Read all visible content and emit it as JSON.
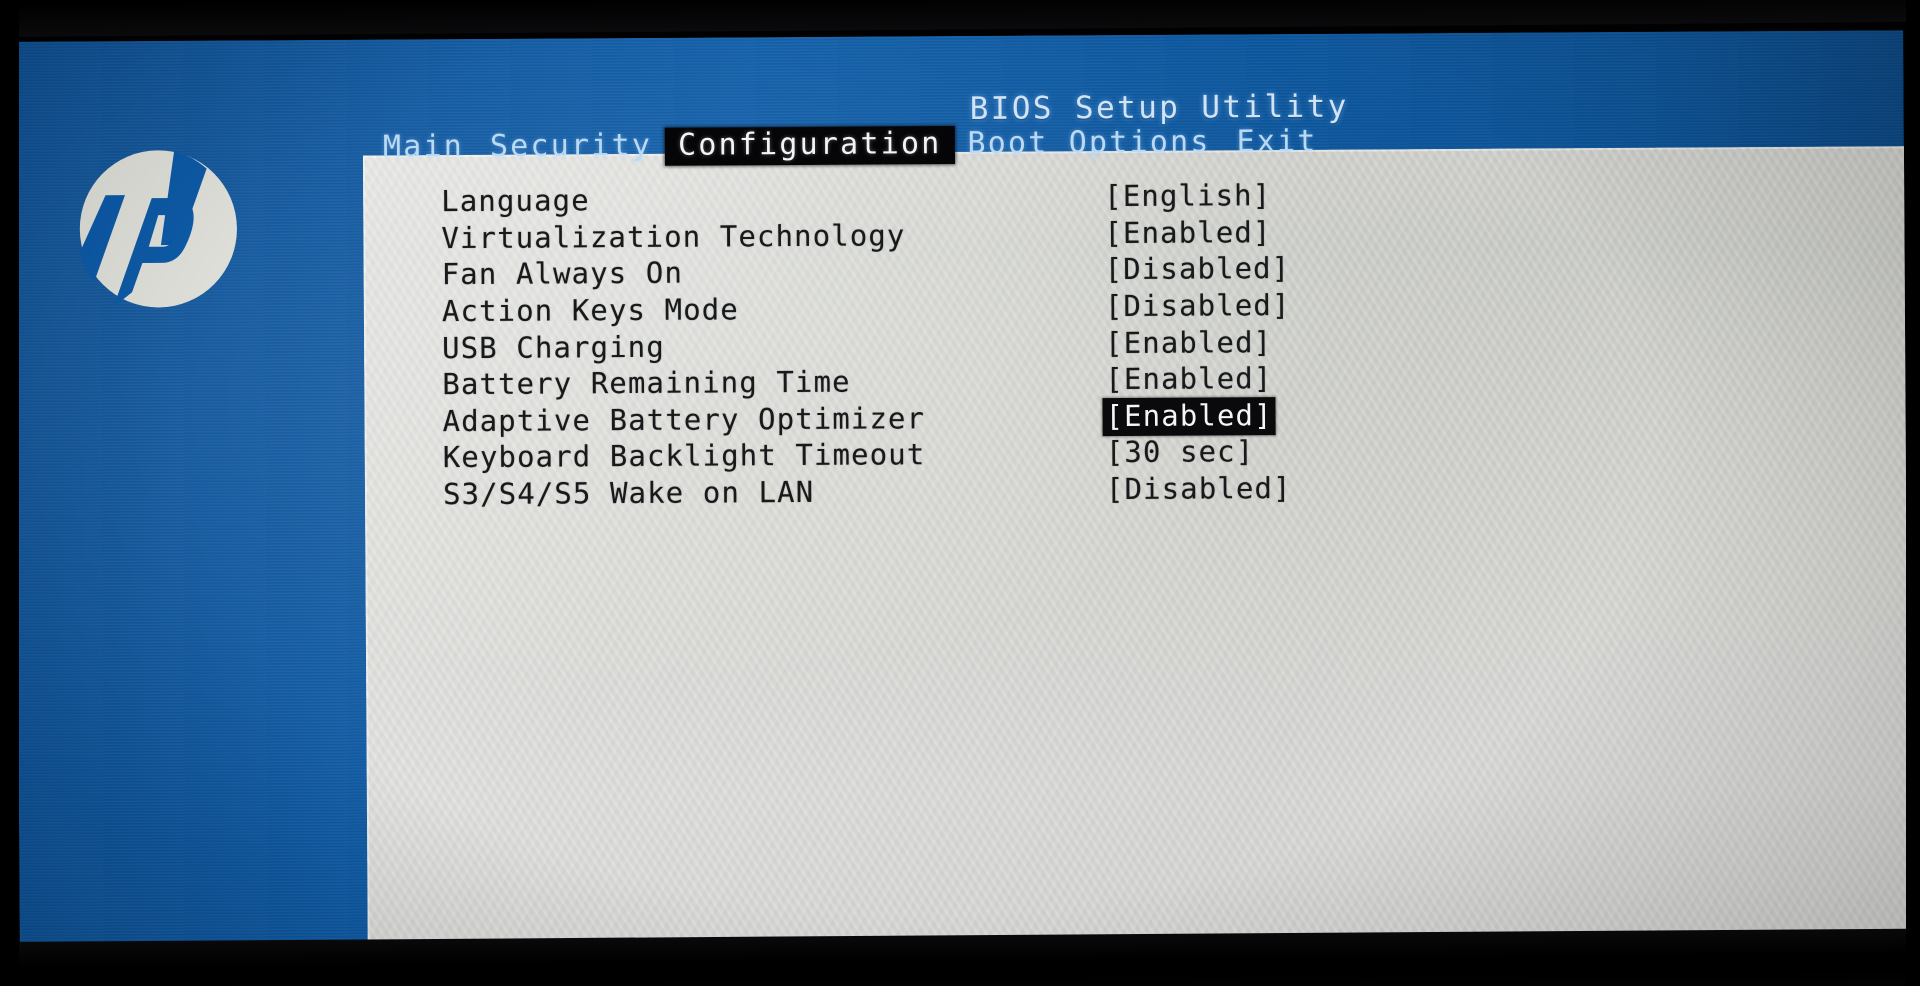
{
  "header": {
    "title": "BIOS Setup Utility"
  },
  "menu": {
    "items": [
      {
        "label": "Main",
        "selected": false
      },
      {
        "label": "Security",
        "selected": false
      },
      {
        "label": "Configuration",
        "selected": true
      },
      {
        "label": "Boot Options",
        "selected": false
      },
      {
        "label": "Exit",
        "selected": false
      }
    ]
  },
  "branding": {
    "logo_name": "hp-logo",
    "logo_text": "hp"
  },
  "colors": {
    "background_blue": "#0d5aa7",
    "panel_gray": "#d6d7d2",
    "highlight_black": "#0a0a0c",
    "menu_text": "#bcd9f2",
    "body_text": "#17191a"
  },
  "settings": {
    "rows": [
      {
        "label": "Language",
        "value": "[English]",
        "highlighted": false
      },
      {
        "label": "Virtualization Technology",
        "value": "[Enabled]",
        "highlighted": false
      },
      {
        "label": "Fan Always On",
        "value": "[Disabled]",
        "highlighted": false
      },
      {
        "label": "Action Keys Mode",
        "value": "[Disabled]",
        "highlighted": false
      },
      {
        "label": "USB Charging",
        "value": "[Enabled]",
        "highlighted": false
      },
      {
        "label": "Battery Remaining Time",
        "value": "[Enabled]",
        "highlighted": false
      },
      {
        "label": "Adaptive Battery Optimizer",
        "value": "[Enabled]",
        "highlighted": true
      },
      {
        "label": "Keyboard Backlight Timeout",
        "value": "[30 sec]",
        "highlighted": false
      },
      {
        "label": "S3/S4/S5 Wake on LAN",
        "value": "[Disabled]",
        "highlighted": false
      }
    ]
  }
}
